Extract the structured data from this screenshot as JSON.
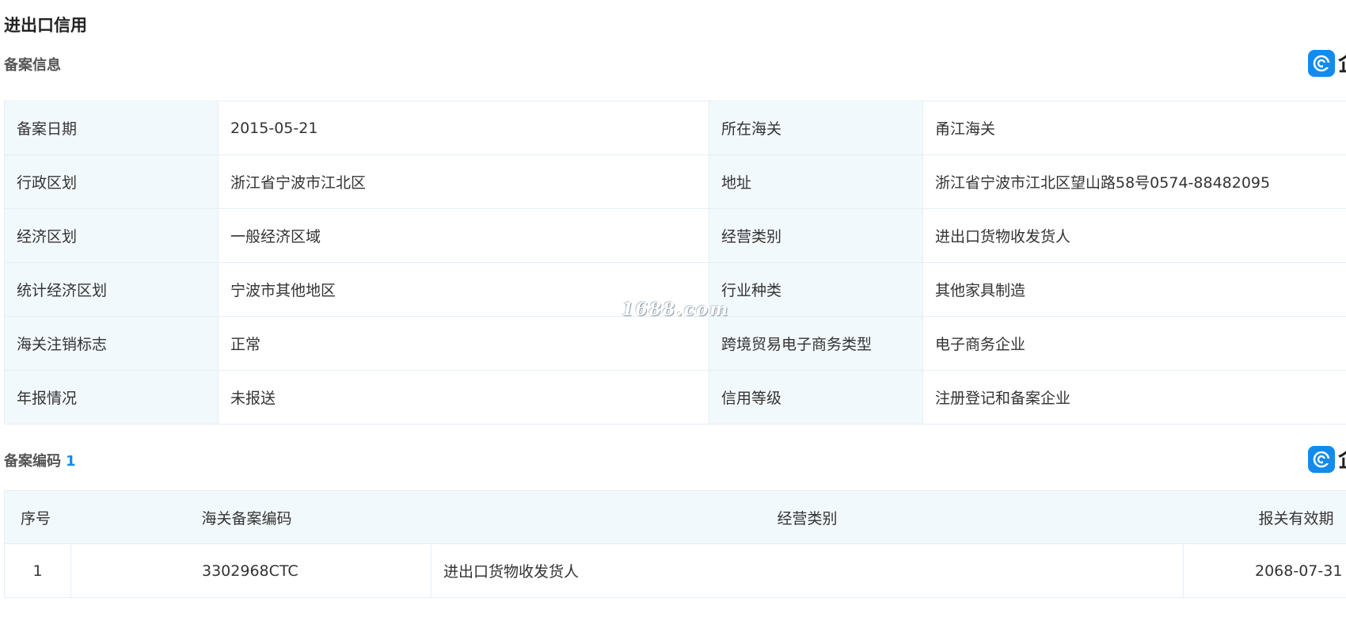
{
  "page_title": "进出口信用",
  "sections": {
    "record_info": {
      "title": "备案信息"
    },
    "record_codes": {
      "title": "备案编码",
      "count": "1"
    }
  },
  "info_rows": [
    {
      "label1": "备案日期",
      "value1": "2015-05-21",
      "label2": "所在海关",
      "value2": "甬江海关"
    },
    {
      "label1": "行政区划",
      "value1": "浙江省宁波市江北区",
      "label2": "地址",
      "value2": "浙江省宁波市江北区望山路58号0574-88482095"
    },
    {
      "label1": "经济区划",
      "value1": "一般经济区域",
      "label2": "经营类别",
      "value2": "进出口货物收发货人"
    },
    {
      "label1": "统计经济区划",
      "value1": "宁波市其他地区",
      "label2": "行业种类",
      "value2": "其他家具制造"
    },
    {
      "label1": "海关注销标志",
      "value1": "正常",
      "label2": "跨境贸易电子商务类型",
      "value2": "电子商务企业"
    },
    {
      "label1": "年报情况",
      "value1": "未报送",
      "label2": "信用等级",
      "value2": "注册登记和备案企业"
    }
  ],
  "code_table": {
    "headers": {
      "index": "序号",
      "code": "海关备案编码",
      "category": "经营类别",
      "validity": "报关有效期"
    },
    "rows": [
      {
        "index": "1",
        "code": "3302968CTC",
        "category": "进出口货物收发货人",
        "validity": "2068-07-31"
      }
    ]
  },
  "watermark": "1688.com",
  "icons": {
    "brand": "brand-logo-icon"
  },
  "colors": {
    "accent": "#128bed",
    "label_bg": "#f2f9fc",
    "border": "#e4eef6"
  }
}
